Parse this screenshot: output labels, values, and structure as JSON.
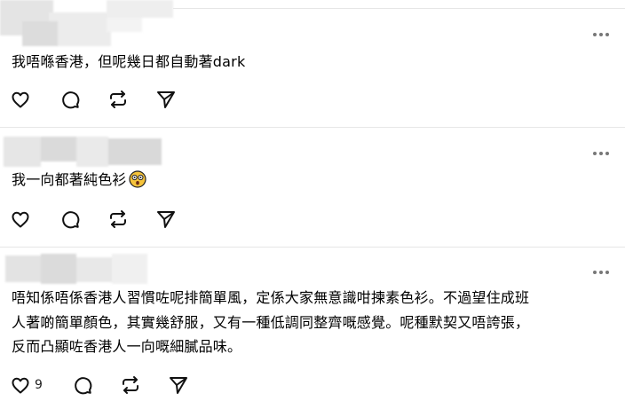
{
  "posts": [
    {
      "text": "我唔喺香港，但呢幾日都自動著dark",
      "like_count": ""
    },
    {
      "text": "我一向都著純色衫",
      "emoji": "astonished-face-emoji",
      "like_count": ""
    },
    {
      "lines": [
        "唔知係唔係香港人習慣咗呢排簡單風，定係大家無意識咁揀素色衫。不過望住成班",
        "人著啲簡單顏色，其實幾舒服，又有一種低調同整齊嘅感覺。呢種默契又唔誇張，",
        "反而凸顯咗香港人一向嘅細膩品味。"
      ],
      "like_count": "9"
    }
  ],
  "icons": [
    "heart-icon",
    "comment-icon",
    "repost-icon",
    "share-icon",
    "more-icon"
  ]
}
